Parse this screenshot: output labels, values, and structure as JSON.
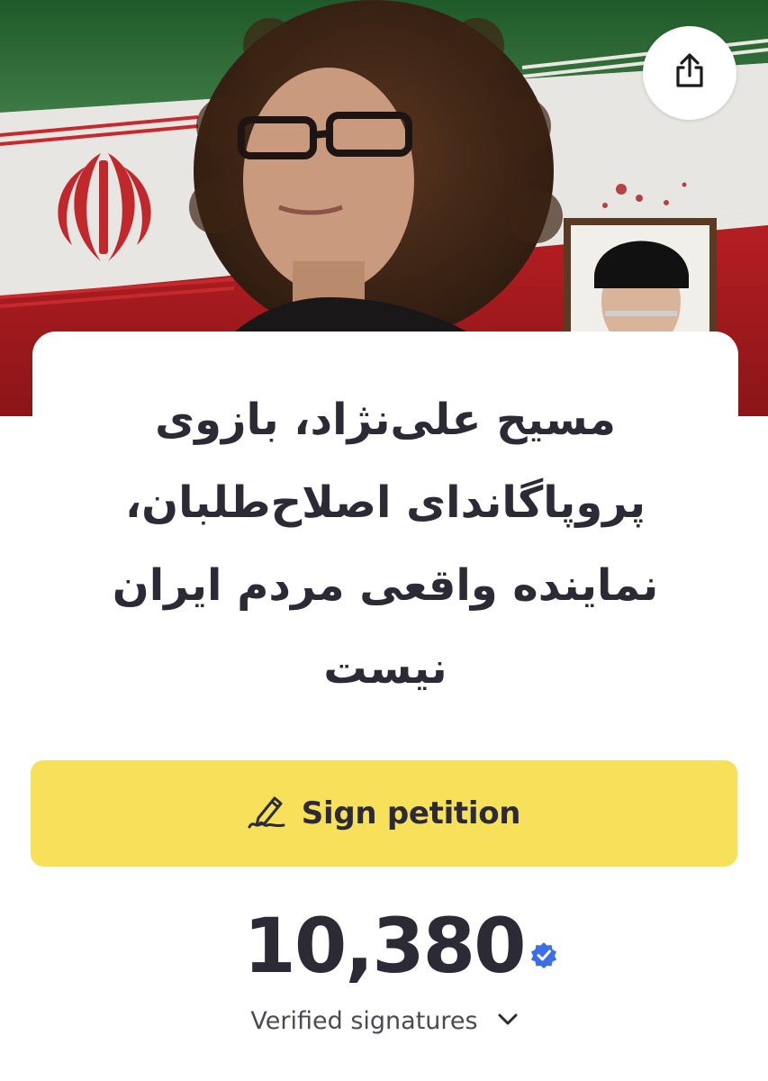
{
  "hero": {
    "image": "petition-cover-photo",
    "share_icon": "share-icon"
  },
  "petition": {
    "title": "مسیح علی‌نژاد، بازوی پروپاگاندای اصلاح‌طلبان، نماینده واقعی مردم ایران نیست"
  },
  "sign": {
    "label": "Sign petition",
    "icon": "pen-signature-icon"
  },
  "signatures": {
    "count": "10,380",
    "label": "Verified signatures",
    "badge_icon": "verified-badge-icon",
    "toggle_icon": "chevron-down-icon"
  },
  "colors": {
    "button": "#f7e15a",
    "text": "#2b2a35",
    "badge": "#3b6ee8"
  }
}
